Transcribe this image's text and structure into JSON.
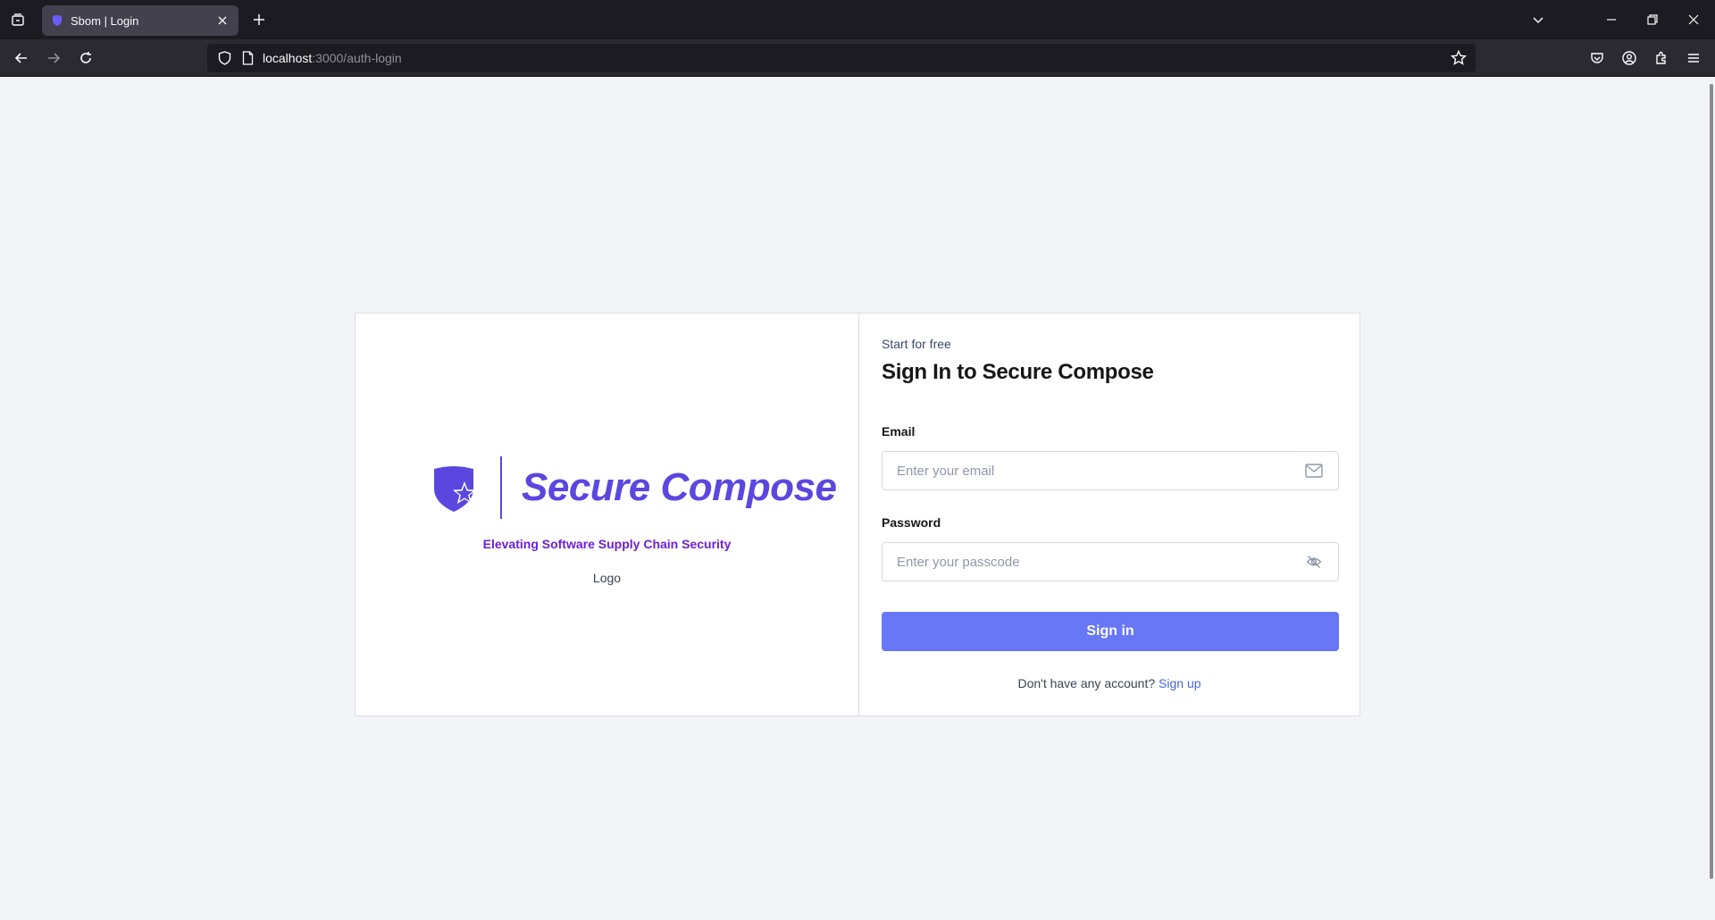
{
  "browser": {
    "tab": {
      "title": "Sbom | Login"
    },
    "url": {
      "host": "localhost",
      "path": ":3000/auth-login"
    }
  },
  "brand": {
    "name": "Secure Compose",
    "tagline": "Elevating Software Supply Chain Security",
    "logo_caption": "Logo",
    "color": "#5b47e0"
  },
  "login": {
    "eyebrow": "Start for free",
    "heading": "Sign In to Secure Compose",
    "email_label": "Email",
    "email_placeholder": "Enter your email",
    "email_value": "",
    "password_label": "Password",
    "password_placeholder": "Enter your passcode",
    "password_value": "",
    "submit_label": "Sign in",
    "signup_prompt": "Don't have any account?",
    "signup_link": "Sign up",
    "button_color": "#6777f6"
  },
  "icons": {
    "email": "envelope-icon",
    "password": "eye-off-icon"
  }
}
